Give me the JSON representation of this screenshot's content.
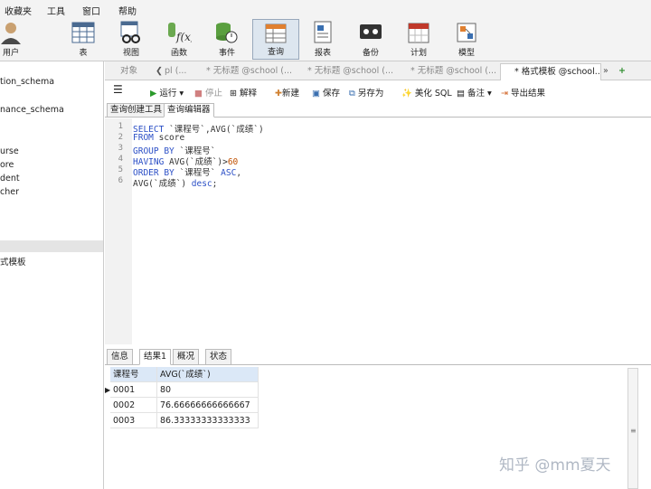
{
  "menu": [
    "收藏夹",
    "工具",
    "窗口",
    "帮助"
  ],
  "toolbar": {
    "user": "用户",
    "table": "表",
    "view": "视图",
    "function": "函数",
    "event": "事件",
    "query": "查询",
    "report": "报表",
    "backup": "备份",
    "schedule": "计划",
    "model": "模型"
  },
  "sidebar": {
    "items": [
      "tion_schema",
      "nance_schema",
      "urse",
      "ore",
      "dent",
      "cher",
      "式模板"
    ]
  },
  "tabs": {
    "object": "对象",
    "t1": "pl (...",
    "t2": "* 无标题 @school (...",
    "t3": "* 无标题 @school (...",
    "t4": "* 无标题 @school (...",
    "t5": "* 格式模板 @school..."
  },
  "query_toolbar": {
    "run": "运行",
    "stop": "停止",
    "explain": "解释",
    "new": "新建",
    "save": "保存",
    "save_as": "另存为",
    "beautify": "美化 SQL",
    "comment": "备注",
    "export": "导出结果"
  },
  "subtabs": {
    "builder": "查询创建工具",
    "editor": "查询编辑器"
  },
  "editor": {
    "line_numbers": [
      "1",
      "2",
      "3",
      "4",
      "5",
      "6"
    ],
    "lines": [
      {
        "kw": "SELECT",
        "rest": " `课程号`,AVG(`成绩`)"
      },
      {
        "kw": "FROM",
        "rest": " score"
      },
      {
        "kw": "GROUP BY",
        "rest": " `课程号`"
      },
      {
        "kw": "HAVING",
        "rest": " AVG(`成绩`)>",
        "num": "60"
      },
      {
        "kw": "ORDER BY",
        "rest": " `课程号` ",
        "kw2": "ASC",
        "tail": ","
      },
      {
        "pre": "AVG(`成绩`) ",
        "kw": "desc",
        "tail": ";"
      }
    ]
  },
  "result_tabs": {
    "info": "信息",
    "result1": "结果1",
    "profile": "概况",
    "status": "状态"
  },
  "result_grid": {
    "columns": [
      "课程号",
      "AVG(`成绩`)"
    ],
    "rows": [
      [
        "0001",
        "80"
      ],
      [
        "0002",
        "76.66666666666667"
      ],
      [
        "0003",
        "86.33333333333333"
      ]
    ]
  },
  "watermark": "知乎 @mm夏天"
}
